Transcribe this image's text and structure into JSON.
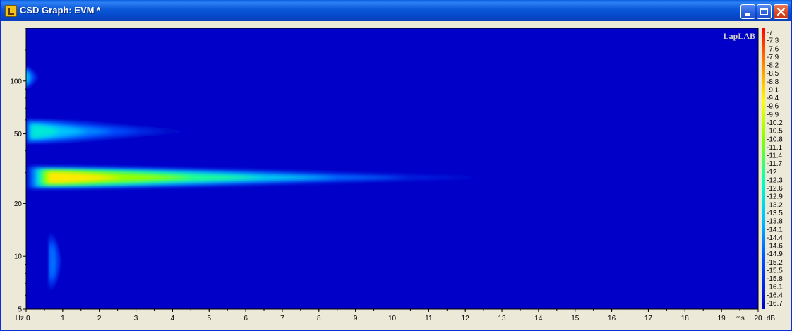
{
  "window": {
    "title": "CSD Graph: EVM *",
    "icons": {
      "app": "app-icon",
      "minimize": "minimize-icon",
      "maximize": "maximize-icon",
      "close": "close-icon"
    }
  },
  "plot": {
    "watermark": "LapLAB",
    "background_color": "#0000c8"
  },
  "chart_data": {
    "type": "heatmap",
    "title": "",
    "x_axis": {
      "unit_left": "Hz",
      "unit_right": "ms",
      "range": [
        0,
        20
      ],
      "ticks": [
        0,
        1,
        2,
        3,
        4,
        5,
        6,
        7,
        8,
        9,
        10,
        11,
        12,
        13,
        14,
        15,
        16,
        17,
        18,
        19,
        20
      ]
    },
    "y_axis": {
      "scale": "log",
      "range": [
        5,
        200
      ],
      "ticks": [
        5,
        10,
        20,
        50,
        100
      ]
    },
    "colorbar": {
      "unit": "dB",
      "range": [
        -16.7,
        -7
      ],
      "labels": [
        "-7",
        "-7.3",
        "-7.6",
        "-7.9",
        "-8.2",
        "-8.5",
        "-8.8",
        "-9.1",
        "-9.4",
        "-9.6",
        "-9.9",
        "-10.2",
        "-10.5",
        "-10.8",
        "-11.1",
        "-11.4",
        "-11.7",
        "-12",
        "-12.3",
        "-12.6",
        "-12.9",
        "-13.2",
        "-13.5",
        "-13.8",
        "-14.1",
        "-14.4",
        "-14.6",
        "-14.9",
        "-15.2",
        "-15.5",
        "-15.8",
        "-16.1",
        "-16.4",
        "-16.7"
      ]
    },
    "regions": [
      {
        "time_ms": [
          0,
          0.45
        ],
        "freq_hz": [
          88,
          125
        ],
        "peak_db": -13.5
      },
      {
        "time_ms": [
          0,
          5.3
        ],
        "freq_hz": [
          43,
          62
        ],
        "peak_db": -12.8
      },
      {
        "time_ms": [
          0,
          14.4
        ],
        "freq_hz": [
          24,
          33
        ],
        "peak_db": -9.3
      },
      {
        "time_ms": [
          0.75,
          1.05
        ],
        "freq_hz": [
          5.8,
          15
        ],
        "peak_db": -14.5
      }
    ]
  }
}
